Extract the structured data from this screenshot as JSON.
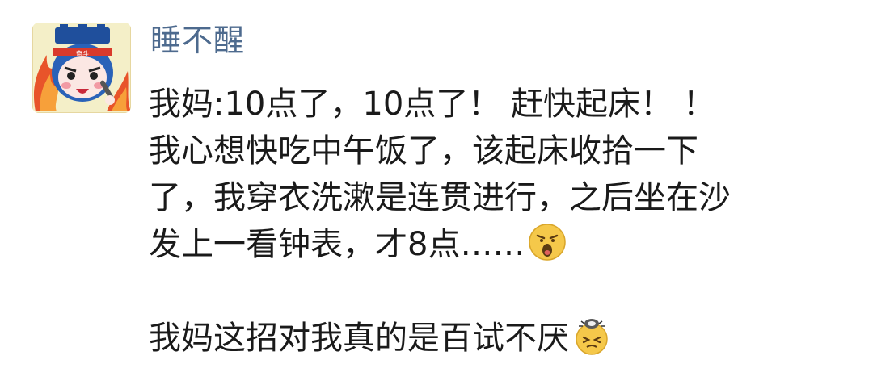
{
  "post": {
    "author": {
      "name": "睡不醒",
      "avatar_icon": "cartoon-mascot-avatar-icon"
    },
    "content": {
      "lines": [
        "我妈:10点了，10点了！ 赶快起床！ ！",
        "我心想快吃中午饭了，该起床收拾一下",
        "了，我穿衣洗漱是连贯进行，之后坐在沙",
        "发上一看钟表，才8点……",
        "",
        "我妈这招对我真的是百试不厌"
      ],
      "emojis": [
        {
          "line": 3,
          "icon": "shocked-face-emoji-icon"
        },
        {
          "line": 5,
          "icon": "dizzy-face-emoji-icon"
        }
      ]
    },
    "colors": {
      "username": "#4d6a8e",
      "text": "#1a1a1a",
      "background": "#ffffff"
    }
  }
}
